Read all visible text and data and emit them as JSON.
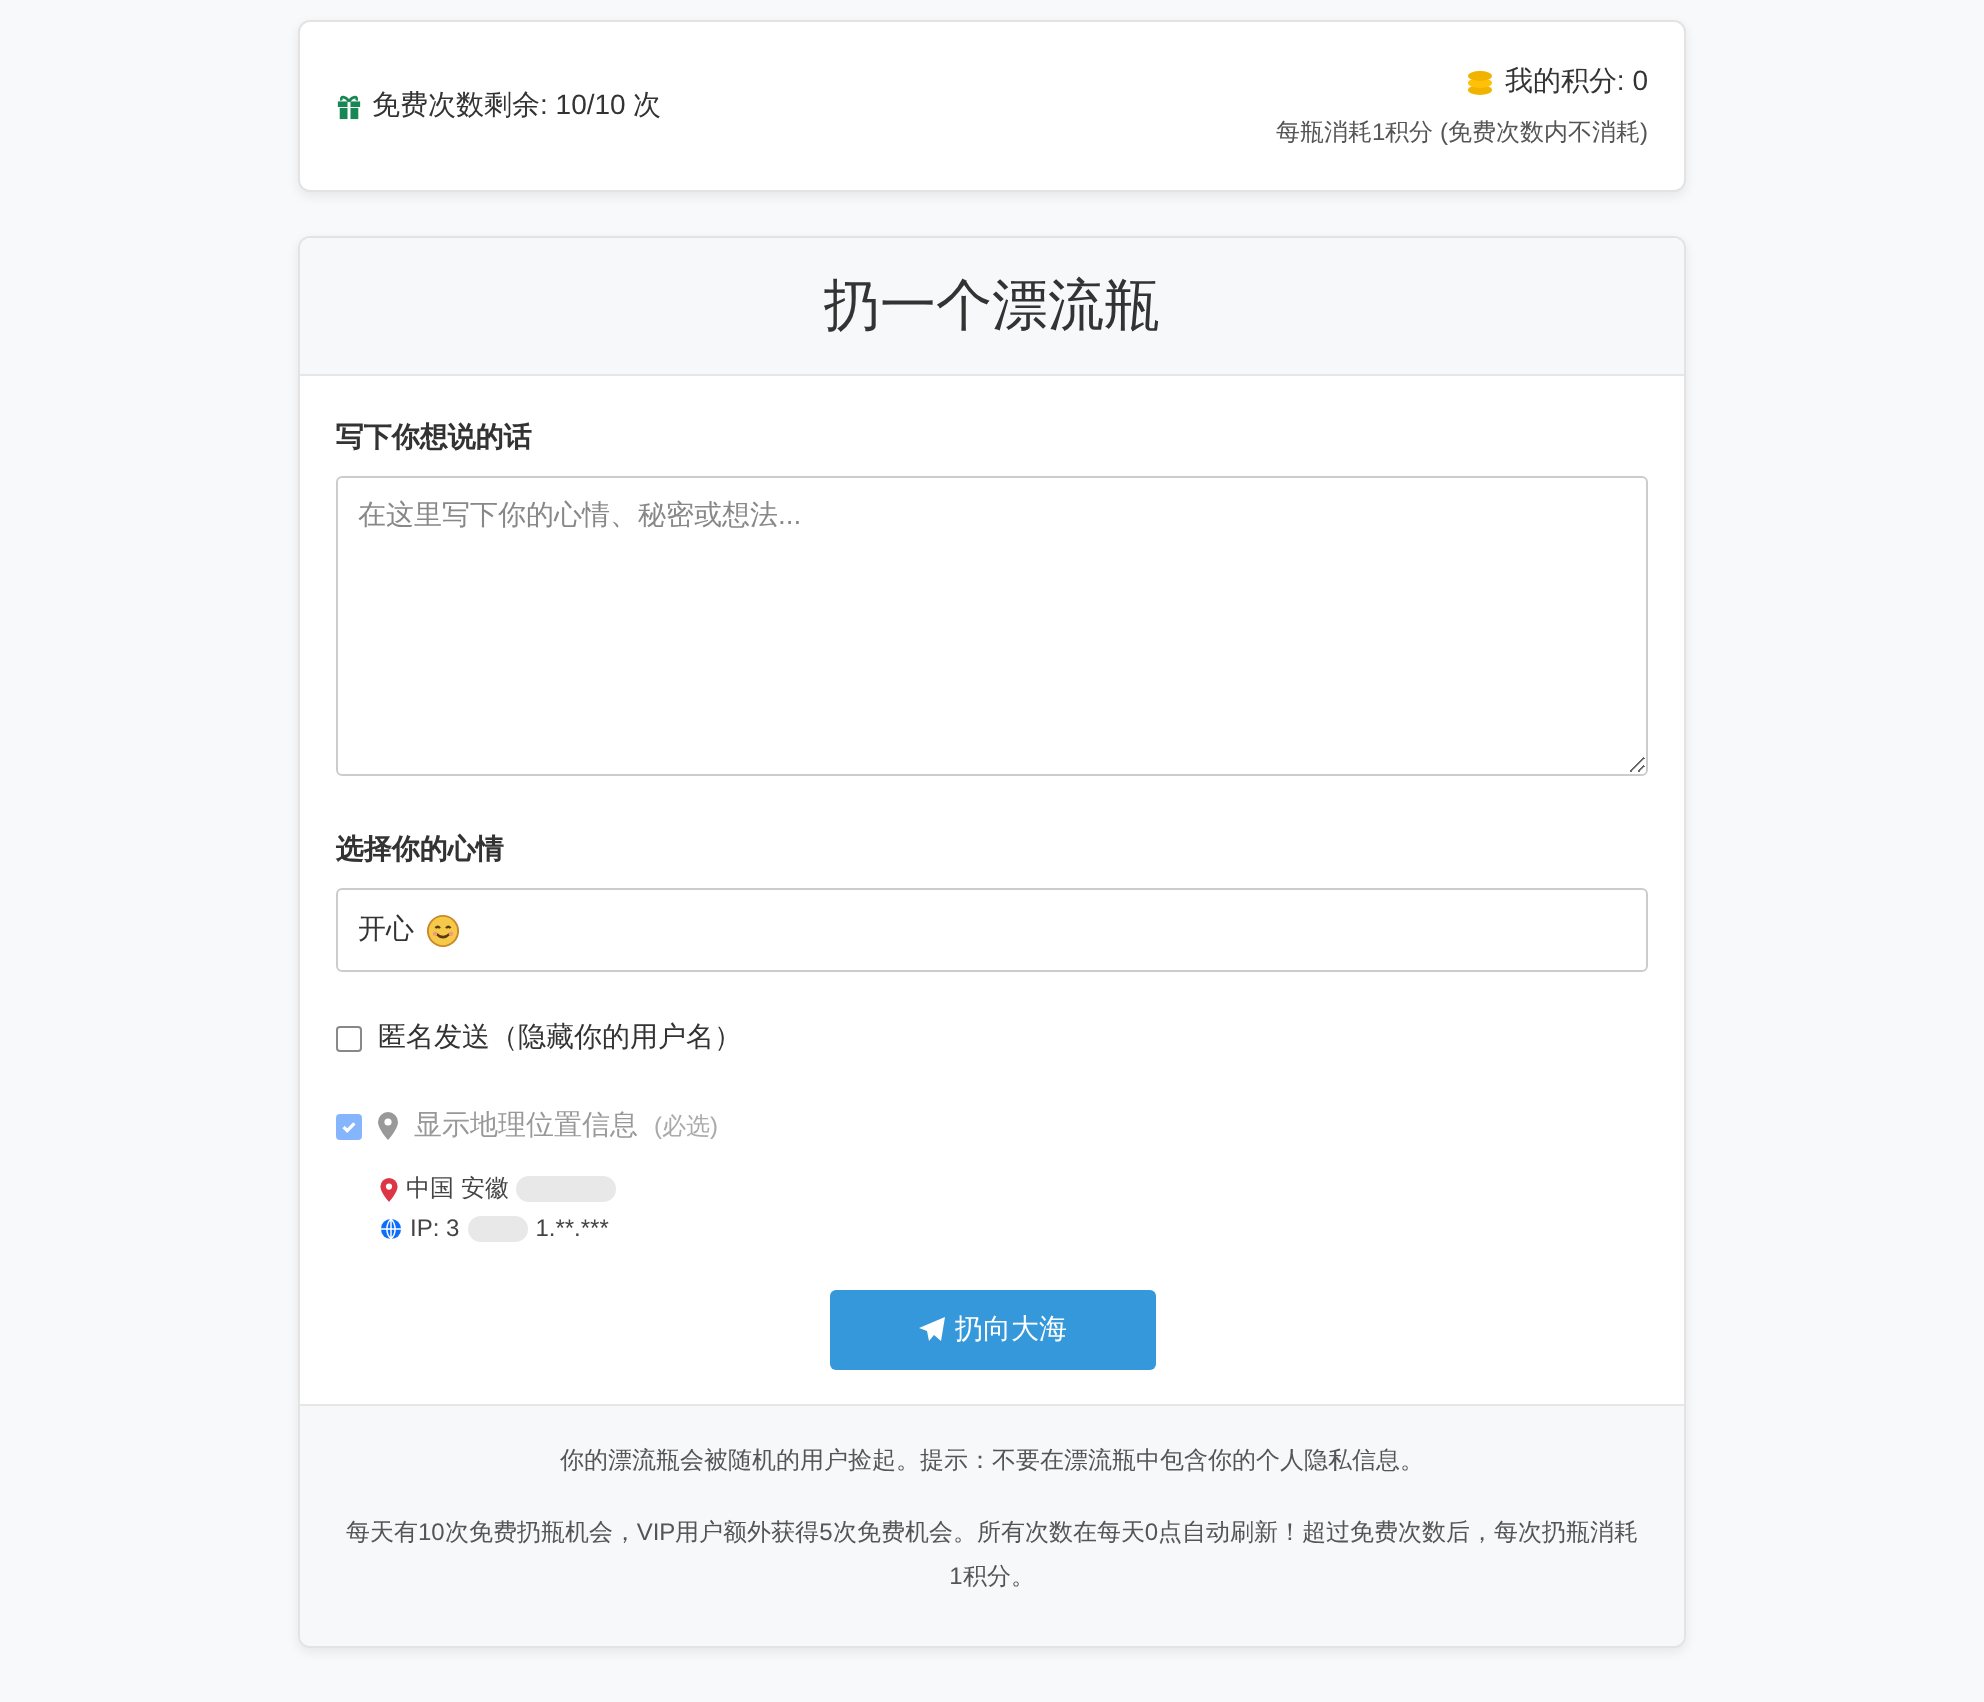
{
  "stats": {
    "free_remaining": "免费次数剩余: 10/10 次",
    "points": "我的积分: 0",
    "cost_note": "每瓶消耗1积分 (免费次数内不消耗)"
  },
  "form": {
    "title": "扔一个漂流瓶",
    "message": {
      "label": "写下你想说的话",
      "placeholder": "在这里写下你的心情、秘密或想法..."
    },
    "mood": {
      "label": "选择你的心情",
      "value": "开心"
    },
    "anonymous": {
      "label": "匿名发送（隐藏你的用户名）",
      "checked": false
    },
    "location": {
      "label": "显示地理位置信息",
      "note": "(必选)",
      "checked": true,
      "disabled": true,
      "place": "中国 安徽",
      "ip_prefix": "IP: 3",
      "ip_suffix": "1.**.***"
    },
    "submit": "扔向大海"
  },
  "footer": [
    "你的漂流瓶会被随机的用户捡起。提示：不要在漂流瓶中包含你的个人隐私信息。",
    "每天有10次免费扔瓶机会，VIP用户额外获得5次免费机会。所有次数在每天0点自动刷新！超过免费次数后，每次扔瓶消耗1积分。"
  ]
}
